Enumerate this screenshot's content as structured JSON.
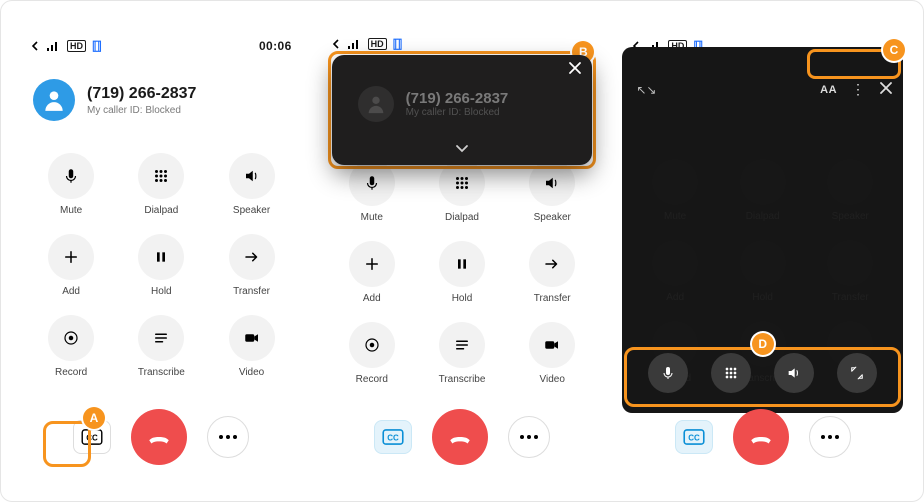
{
  "status": {
    "timer": "00:06",
    "hd": "HD"
  },
  "caller": {
    "number": "(719) 266-2837",
    "sub": "My caller ID: Blocked"
  },
  "actions": {
    "mute": "Mute",
    "dialpad": "Dialpad",
    "speaker": "Speaker",
    "add": "Add",
    "hold": "Hold",
    "transfer": "Transfer",
    "record": "Record",
    "transcribe": "Transcribe",
    "video": "Video"
  },
  "captions": {
    "cc": "CC"
  },
  "overlay_b": {
    "number": "(719) 266-2837",
    "sub": "My caller ID: Blocked"
  },
  "overlay_c": {
    "aa": "AA"
  },
  "callouts": {
    "a": "A",
    "b": "B",
    "c": "C",
    "d": "D"
  }
}
